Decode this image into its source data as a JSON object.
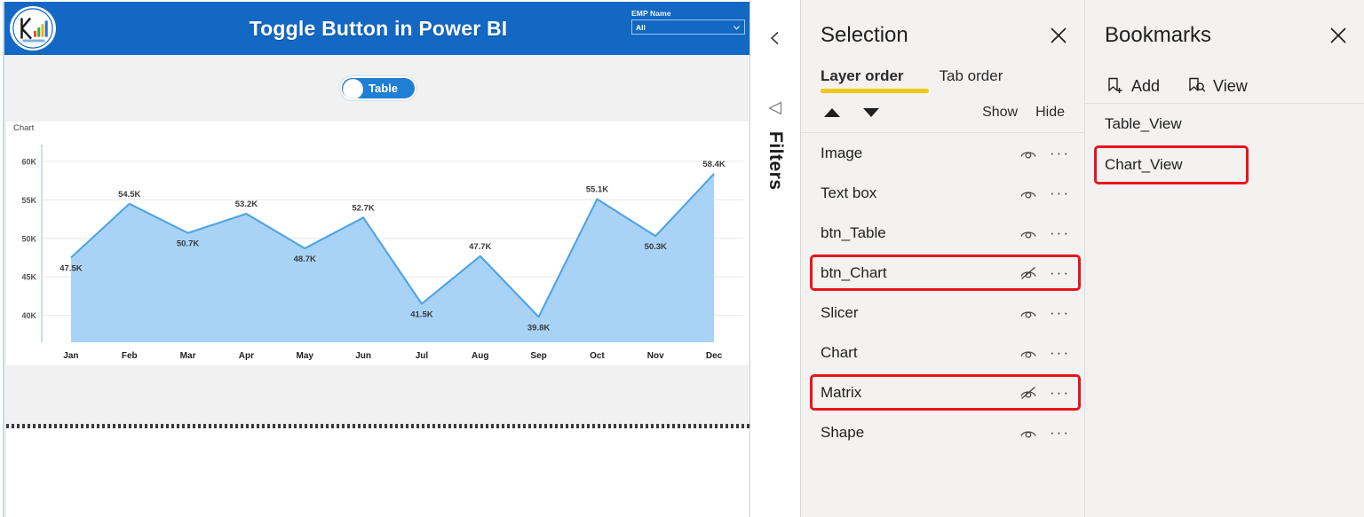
{
  "report": {
    "header": {
      "title": "Toggle Button in Power BI",
      "logo_icon": "company-logo-icon",
      "slicer": {
        "label": "EMP Name",
        "value": "All",
        "caret_icon": "chevron-down-icon"
      }
    },
    "toggle": {
      "label": "Table",
      "state": "off"
    },
    "chart_data": {
      "type": "area",
      "title": "Chart",
      "xlabel": "",
      "ylabel": "",
      "categories": [
        "Jan",
        "Feb",
        "Mar",
        "Apr",
        "May",
        "Jun",
        "Jul",
        "Aug",
        "Sep",
        "Oct",
        "Nov",
        "Dec"
      ],
      "values": [
        47500,
        54500,
        50700,
        53200,
        48700,
        52700,
        41500,
        47700,
        39800,
        55100,
        50300,
        58400
      ],
      "data_labels": [
        "47.5K",
        "54.5K",
        "50.7K",
        "53.2K",
        "48.7K",
        "52.7K",
        "41.5K",
        "47.7K",
        "39.8K",
        "55.1K",
        "50.3K",
        "58.4K"
      ],
      "ytick_labels": [
        "40K",
        "45K",
        "50K",
        "55K",
        "60K"
      ],
      "ytick_values": [
        40000,
        45000,
        50000,
        55000,
        60000
      ],
      "ylim": [
        36500,
        61500
      ],
      "grid": true,
      "legend": "none",
      "line_color": "#4fa3e3",
      "fill_color": "#a8d3f7"
    }
  },
  "filters_rail": {
    "expand_icon": "chevron-left-icon",
    "funnel_icon": "filter-funnel-icon",
    "label": "Filters"
  },
  "selection_pane": {
    "title": "Selection",
    "close_icon": "close-icon",
    "tabs": [
      {
        "label": "Layer order",
        "active": true
      },
      {
        "label": "Tab order",
        "active": false
      }
    ],
    "move_up_icon": "arrow-up-icon",
    "move_down_icon": "arrow-down-icon",
    "show_label": "Show",
    "hide_label": "Hide",
    "accent_color": "#f2c811",
    "highlight_color": "#e8141c",
    "layers": [
      {
        "name": "Image",
        "visible": true,
        "highlighted": false
      },
      {
        "name": "Text box",
        "visible": true,
        "highlighted": false
      },
      {
        "name": "btn_Table",
        "visible": true,
        "highlighted": false
      },
      {
        "name": "btn_Chart",
        "visible": false,
        "highlighted": true
      },
      {
        "name": "Slicer",
        "visible": true,
        "highlighted": false
      },
      {
        "name": "Chart",
        "visible": true,
        "highlighted": false
      },
      {
        "name": "Matrix",
        "visible": false,
        "highlighted": true
      },
      {
        "name": "Shape",
        "visible": true,
        "highlighted": false
      }
    ]
  },
  "bookmarks_pane": {
    "title": "Bookmarks",
    "close_icon": "close-icon",
    "actions": [
      {
        "label": "Add",
        "icon": "bookmark-add-icon"
      },
      {
        "label": "View",
        "icon": "bookmark-view-icon"
      }
    ],
    "bookmarks": [
      {
        "name": "Table_View",
        "highlighted": false
      },
      {
        "name": "Chart_View",
        "highlighted": true
      }
    ]
  }
}
